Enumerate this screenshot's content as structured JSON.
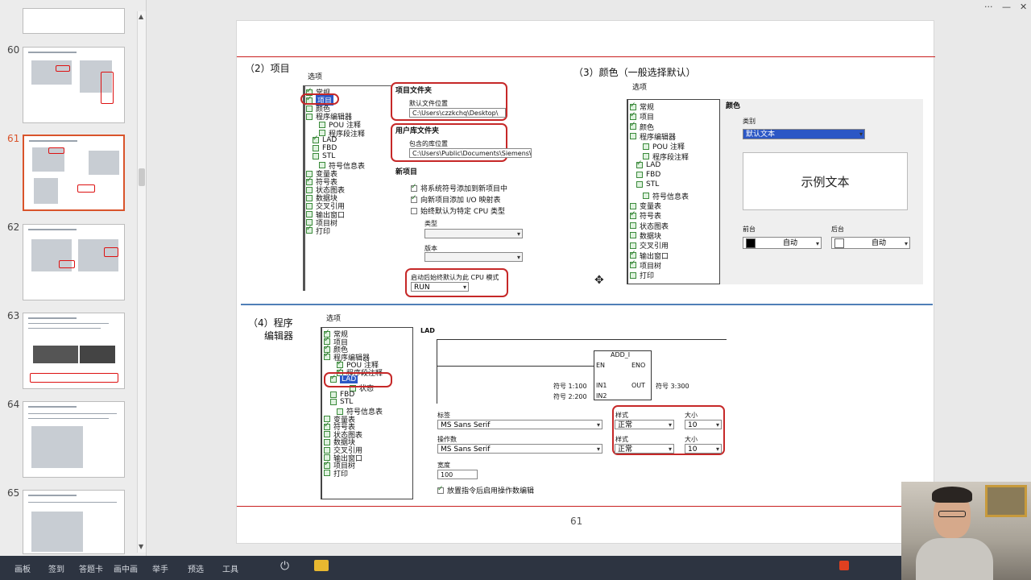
{
  "thumbnails": [
    {
      "num": "60",
      "active": false
    },
    {
      "num": "61",
      "active": true
    },
    {
      "num": "62",
      "active": false
    },
    {
      "num": "63",
      "active": false
    },
    {
      "num": "64",
      "active": false
    },
    {
      "num": "65",
      "active": false
    }
  ],
  "slide": {
    "page_number": "61",
    "section2": {
      "title": "（2）项目",
      "options_label": "选项",
      "tree": [
        "常规",
        "项目",
        "颜色",
        "程序编辑器",
        "POU 注释",
        "程序段注释",
        "LAD",
        "FBD",
        "STL",
        "符号信息表",
        "变量表",
        "符号表",
        "状态图表",
        "数据块",
        "交叉引用",
        "输出窗口",
        "项目树",
        "打印"
      ],
      "project_folder": "项目文件夹",
      "default_location_label": "默认文件位置",
      "default_location": "C:\\Users\\czzkchq\\Desktop\\",
      "user_lib_folder": "用户库文件夹",
      "lib_location_label": "包含的库位置",
      "lib_location": "C:\\Users\\Public\\Documents\\Siemens\\S",
      "new_project": "新项目",
      "opt1": "将系统符号添加到新项目中",
      "opt2": "向新项目添加 I/O 映射表",
      "opt3": "始终默认为特定 CPU 类型",
      "type_label": "类型",
      "version_label": "版本",
      "cpu_mode_label": "启动后始终默认为此 CPU 模式",
      "cpu_mode_value": "RUN"
    },
    "section3": {
      "title": "（3）颜色（一般选择默认）",
      "options_label": "选项",
      "tree": [
        "常规",
        "项目",
        "颜色",
        "程序编辑器",
        "POU 注释",
        "程序段注释",
        "LAD",
        "FBD",
        "STL",
        "符号信息表",
        "变量表",
        "符号表",
        "状态图表",
        "数据块",
        "交叉引用",
        "输出窗口",
        "项目树",
        "打印"
      ],
      "color_heading": "颜色",
      "category_label": "类别",
      "category_value": "默认文本",
      "sample_text": "示例文本",
      "foreground_label": "前台",
      "foreground_value": "自动",
      "background_label": "后台",
      "background_value": "自动"
    },
    "section4": {
      "title_line1": "（4）程序",
      "title_line2": "编辑器",
      "options_label": "选项",
      "tree": [
        "常规",
        "项目",
        "颜色",
        "程序编辑器",
        "POU 注释",
        "程序段注释",
        "LAD",
        "状态",
        "FBD",
        "STL",
        "符号信息表",
        "变量表",
        "符号表",
        "状态图表",
        "数据块",
        "交叉引用",
        "输出窗口",
        "项目树",
        "打印"
      ],
      "lad_label": "LAD",
      "block_name": "ADD_I",
      "en": "EN",
      "eno": "ENO",
      "in1": "IN1",
      "in2": "IN2",
      "out": "OUT",
      "sym1": "符号 1:100",
      "sym2": "符号 2:200",
      "sym3": "符号 3:300",
      "tag_label": "标签",
      "tag_font": "MS Sans Serif",
      "operand_label": "操作数",
      "operand_font": "MS Sans Serif",
      "style_label": "样式",
      "style_value": "正常",
      "size_label": "大小",
      "size_value": "10",
      "width_label": "宽度",
      "width_value": "100",
      "edit_option": "放置指令后启用操作数编辑"
    }
  },
  "taskbar": {
    "items": [
      "画板",
      "签到",
      "答题卡",
      "画中画",
      "举手",
      "预选",
      "工具"
    ]
  },
  "window": {
    "more": "···",
    "minimize": "—",
    "close": "✕"
  }
}
